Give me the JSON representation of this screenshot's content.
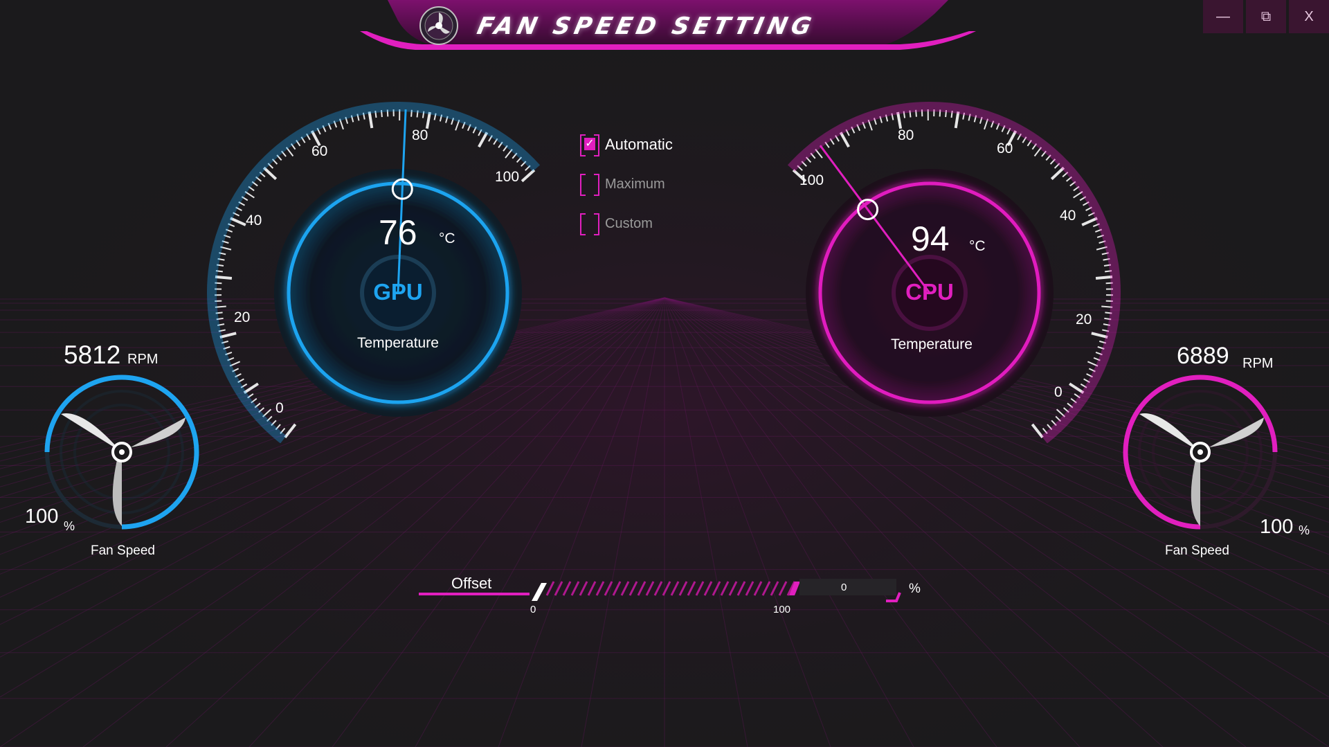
{
  "app": {
    "title": "FAN SPEED SETTING",
    "accent": "#e11fbf",
    "gpu_color": "#1ea4f0",
    "cpu_color": "#e11fbf"
  },
  "window_controls": {
    "minimize_icon": "minimize-icon",
    "restore_icon": "restore-icon",
    "close_icon": "close-icon",
    "minimize_glyph": "—",
    "restore_glyph": "⧉",
    "close_glyph": "X"
  },
  "gpu": {
    "chip": "GPU",
    "temperature": "76",
    "temp_unit": "°C",
    "temp_label": "Temperature",
    "scale_ticks": [
      "0",
      "20",
      "40",
      "60",
      "80",
      "100"
    ],
    "fan_rpm": "5812",
    "rpm_unit": "RPM",
    "fan_percent": "100",
    "percent_unit": "%",
    "fan_label": "Fan Speed"
  },
  "cpu": {
    "chip": "CPU",
    "temperature": "94",
    "temp_unit": "°C",
    "temp_label": "Temperature",
    "scale_ticks": [
      "0",
      "20",
      "40",
      "60",
      "80",
      "100"
    ],
    "fan_rpm": "6889",
    "rpm_unit": "RPM",
    "fan_percent": "100",
    "percent_unit": "%",
    "fan_label": "Fan Speed"
  },
  "modes": [
    {
      "label": "Automatic",
      "checked": true
    },
    {
      "label": "Maximum",
      "checked": false
    },
    {
      "label": "Custom",
      "checked": false
    }
  ],
  "offset": {
    "label": "Offset",
    "min_label": "0",
    "max_label": "100",
    "value": "0",
    "unit": "%"
  }
}
